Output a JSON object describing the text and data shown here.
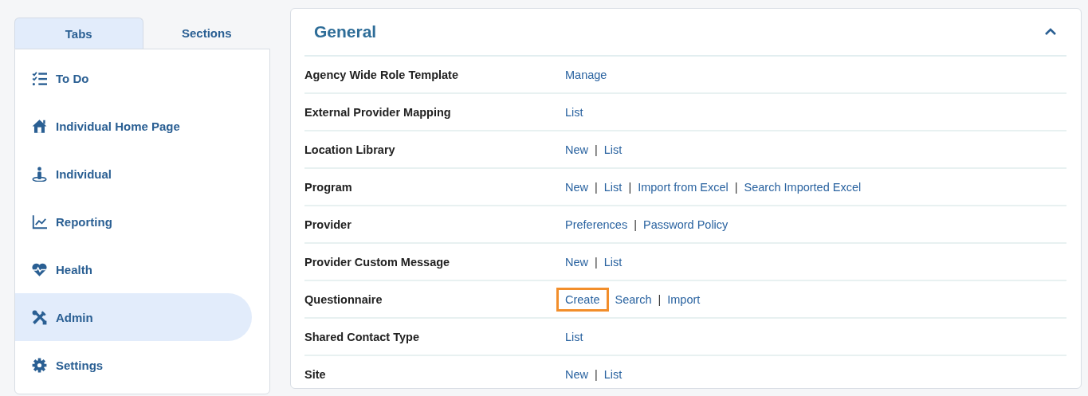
{
  "tabs": [
    {
      "label": "Tabs",
      "selected": true
    },
    {
      "label": "Sections",
      "selected": false
    }
  ],
  "nav_items": [
    {
      "label": "To Do",
      "kind": "todo",
      "selected": false
    },
    {
      "label": "Individual Home Page",
      "kind": "home",
      "selected": false
    },
    {
      "label": "Individual",
      "kind": "person",
      "selected": false
    },
    {
      "label": "Reporting",
      "kind": "chart",
      "selected": false
    },
    {
      "label": "Health",
      "kind": "heart",
      "selected": false
    },
    {
      "label": "Admin",
      "kind": "tools",
      "selected": true
    },
    {
      "label": "Settings",
      "kind": "gear",
      "selected": false
    }
  ],
  "section": {
    "title": "General",
    "expanded": true,
    "rows": [
      {
        "label": "Agency Wide Role Template",
        "actions": [
          {
            "kind": "link",
            "text": "Manage",
            "highlighted": false
          }
        ]
      },
      {
        "label": "External Provider Mapping",
        "actions": [
          {
            "kind": "link",
            "text": "List",
            "highlighted": false
          }
        ]
      },
      {
        "label": "Location Library",
        "actions": [
          {
            "kind": "link",
            "text": "New",
            "highlighted": false
          },
          {
            "kind": "separator",
            "text": "|"
          },
          {
            "kind": "link",
            "text": "List",
            "highlighted": false
          }
        ]
      },
      {
        "label": "Program",
        "actions": [
          {
            "kind": "link",
            "text": "New",
            "highlighted": false
          },
          {
            "kind": "separator",
            "text": "|"
          },
          {
            "kind": "link",
            "text": "List",
            "highlighted": false
          },
          {
            "kind": "separator",
            "text": "|"
          },
          {
            "kind": "link",
            "text": "Import from Excel",
            "highlighted": false
          },
          {
            "kind": "separator",
            "text": "|"
          },
          {
            "kind": "link",
            "text": "Search Imported Excel",
            "highlighted": false
          }
        ]
      },
      {
        "label": "Provider",
        "actions": [
          {
            "kind": "link",
            "text": "Preferences",
            "highlighted": false
          },
          {
            "kind": "separator",
            "text": "|"
          },
          {
            "kind": "link",
            "text": "Password Policy",
            "highlighted": false
          }
        ]
      },
      {
        "label": "Provider Custom Message",
        "actions": [
          {
            "kind": "link",
            "text": "New",
            "highlighted": false
          },
          {
            "kind": "separator",
            "text": "|"
          },
          {
            "kind": "link",
            "text": "List",
            "highlighted": false
          }
        ]
      },
      {
        "label": "Questionnaire",
        "actions": [
          {
            "kind": "link",
            "text": "Create",
            "highlighted": true
          },
          {
            "kind": "link",
            "text": "Search",
            "highlighted": false
          },
          {
            "kind": "separator",
            "text": "|"
          },
          {
            "kind": "link",
            "text": "Import",
            "highlighted": false
          }
        ]
      },
      {
        "label": "Shared Contact Type",
        "actions": [
          {
            "kind": "link",
            "text": "List",
            "highlighted": false
          }
        ]
      },
      {
        "label": "Site",
        "actions": [
          {
            "kind": "link",
            "text": "New",
            "highlighted": false
          },
          {
            "kind": "separator",
            "text": "|"
          },
          {
            "kind": "link",
            "text": "List",
            "highlighted": false
          }
        ]
      }
    ]
  }
}
